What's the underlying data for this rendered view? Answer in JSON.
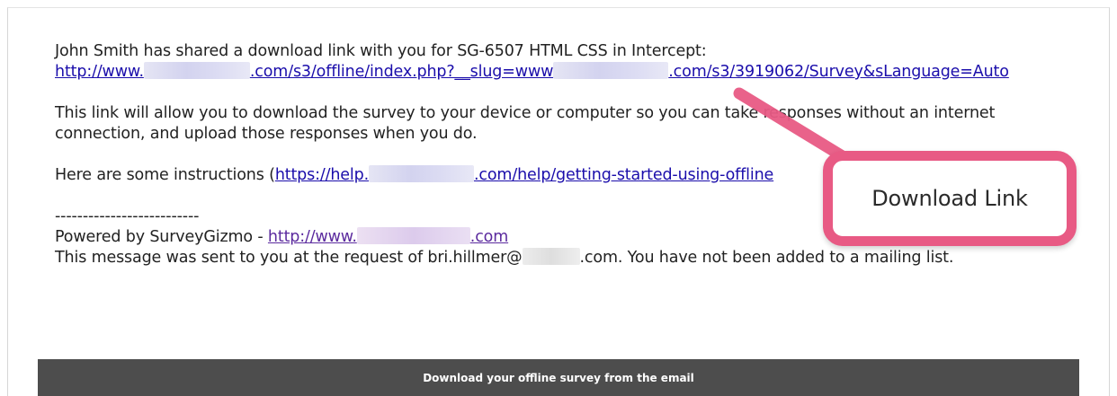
{
  "email": {
    "intro": "John Smith has shared a download link with you for SG-6507 HTML CSS in Intercept:",
    "link_prefix": "http://www.",
    "link_middle": ".com/s3/offline/index.php?__slug=www",
    "link_suffix": ".com/s3/3919062/Survey&sLanguage=Auto",
    "body_line1": "This link will allow you to download the survey to your device or computer so you can take responses without an internet",
    "body_line2": "connection, and upload those responses when you do.",
    "instructions_prefix": " Here are some instructions (",
    "instructions_link_a": "https://help.",
    "instructions_link_b": ".com/help/getting-started-using-offline",
    "divider": "--------------------------",
    "powered_by_prefix": "Powered by SurveyGizmo - ",
    "powered_by_link_a": "http://www.",
    "powered_by_link_b": ".com",
    "notice_prefix": "This message was sent to you at the request of bri.hillmer@",
    "notice_suffix": ".com.  You have not been added to a mailing list."
  },
  "callout": {
    "label": "Download Link",
    "color": "#e85a84"
  },
  "caption": {
    "text": "Download your offline survey from the email"
  }
}
